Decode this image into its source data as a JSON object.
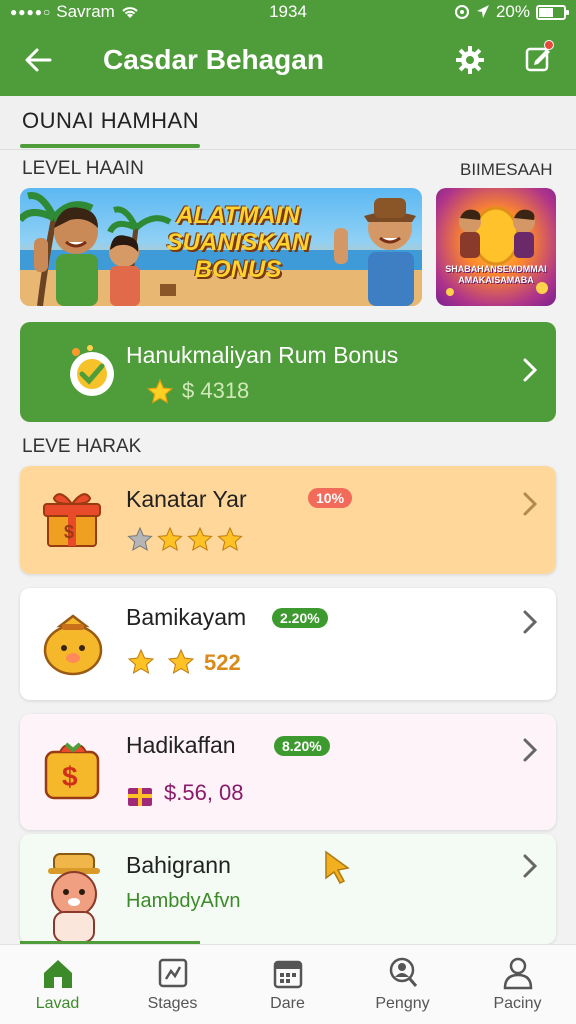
{
  "status_bar": {
    "carrier": "Savram",
    "time": "1934",
    "battery": "20%"
  },
  "app_bar": {
    "title": "Casdar Behagan"
  },
  "tabs": {
    "active": "OUNAI HAMHAN"
  },
  "sections": {
    "level_label": "LEVEL HAAIN",
    "right_label": "BIIMESAAH",
    "second_label": "LEVE HARAK"
  },
  "banner": {
    "main_text": "ALATMAIN SUANISKAN BONUS",
    "side_text": "SHABAHANSEMDMMAI AMAKAISAMABA"
  },
  "highlight": {
    "title": "Hanukmaliyan Rum Bonus",
    "amount": "$ 4318",
    "icon": "reward-badge-icon"
  },
  "list": [
    {
      "title": "Kanatar Yar",
      "badge": "10%",
      "rating": "3.5",
      "icon": "gift-box-icon"
    },
    {
      "title": "Bamikayam",
      "badge": "2.20%",
      "value": "522",
      "icon": "money-bag-icon"
    },
    {
      "title": "Hadikaffan",
      "badge": "8.20%",
      "value": "$.56, 08",
      "icon": "dollar-gift-icon"
    },
    {
      "title": "Bahigrann",
      "subtitle": "HambdyAfvn",
      "icon": "hamster-chef-icon"
    }
  ],
  "bottom_nav": [
    {
      "label": "Lavad",
      "icon": "home-icon"
    },
    {
      "label": "Stages",
      "icon": "stages-icon"
    },
    {
      "label": "Dare",
      "icon": "calendar-icon"
    },
    {
      "label": "Pengny",
      "icon": "search-user-icon"
    },
    {
      "label": "Paciny",
      "icon": "profile-icon"
    }
  ],
  "colors": {
    "primary_green": "#4f9d3a",
    "highlight_card": "#ffd79a",
    "badge_red": "#f26a5a",
    "badge_green": "#3d9a2e",
    "amount_purple": "#8a1a6a"
  }
}
